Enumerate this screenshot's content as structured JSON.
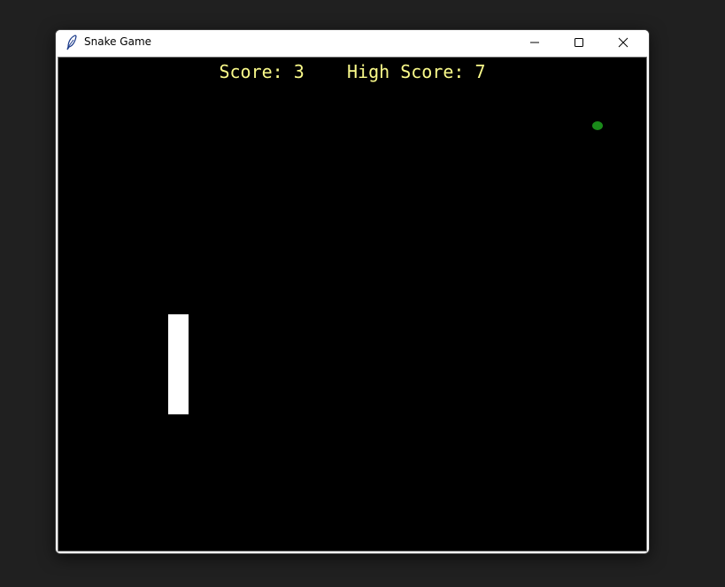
{
  "window": {
    "title": "Snake Game",
    "app_icon": "feather-icon",
    "controls": {
      "minimize": "minimize-icon",
      "maximize": "maximize-icon",
      "close": "close-icon"
    }
  },
  "game": {
    "score_label": "Score:",
    "score": "3",
    "high_score_label": "High Score:",
    "high_score": "7",
    "colors": {
      "background": "#000000",
      "text": "#fafa8a",
      "snake": "#ffffff",
      "food": "#1a8a1a"
    }
  }
}
